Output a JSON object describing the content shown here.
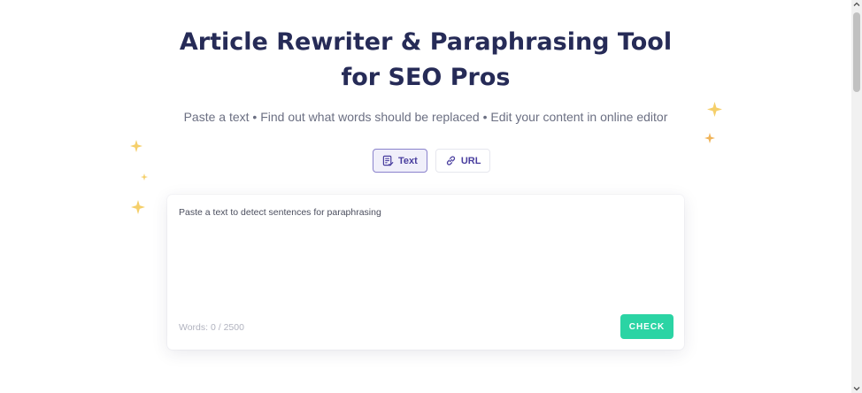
{
  "header": {
    "title": "Article Rewriter & Paraphrasing Tool for SEO Pros",
    "subtitle": "Paste a text • Find out what words should be replaced • Edit your content in online editor"
  },
  "tabs": [
    {
      "label": "Text",
      "icon": "text-document-icon",
      "active": true
    },
    {
      "label": "URL",
      "icon": "link-icon",
      "active": false
    }
  ],
  "editor": {
    "placeholder": "Paste a text to detect sentences for paraphrasing",
    "value": "",
    "word_count": "Words: 0 / 2500",
    "check_label": "CHECK"
  },
  "colors": {
    "title": "#262b57",
    "accent": "#4a3f9f",
    "check_button": "#2bd4a4",
    "sparkle": "#f5cf6a"
  }
}
